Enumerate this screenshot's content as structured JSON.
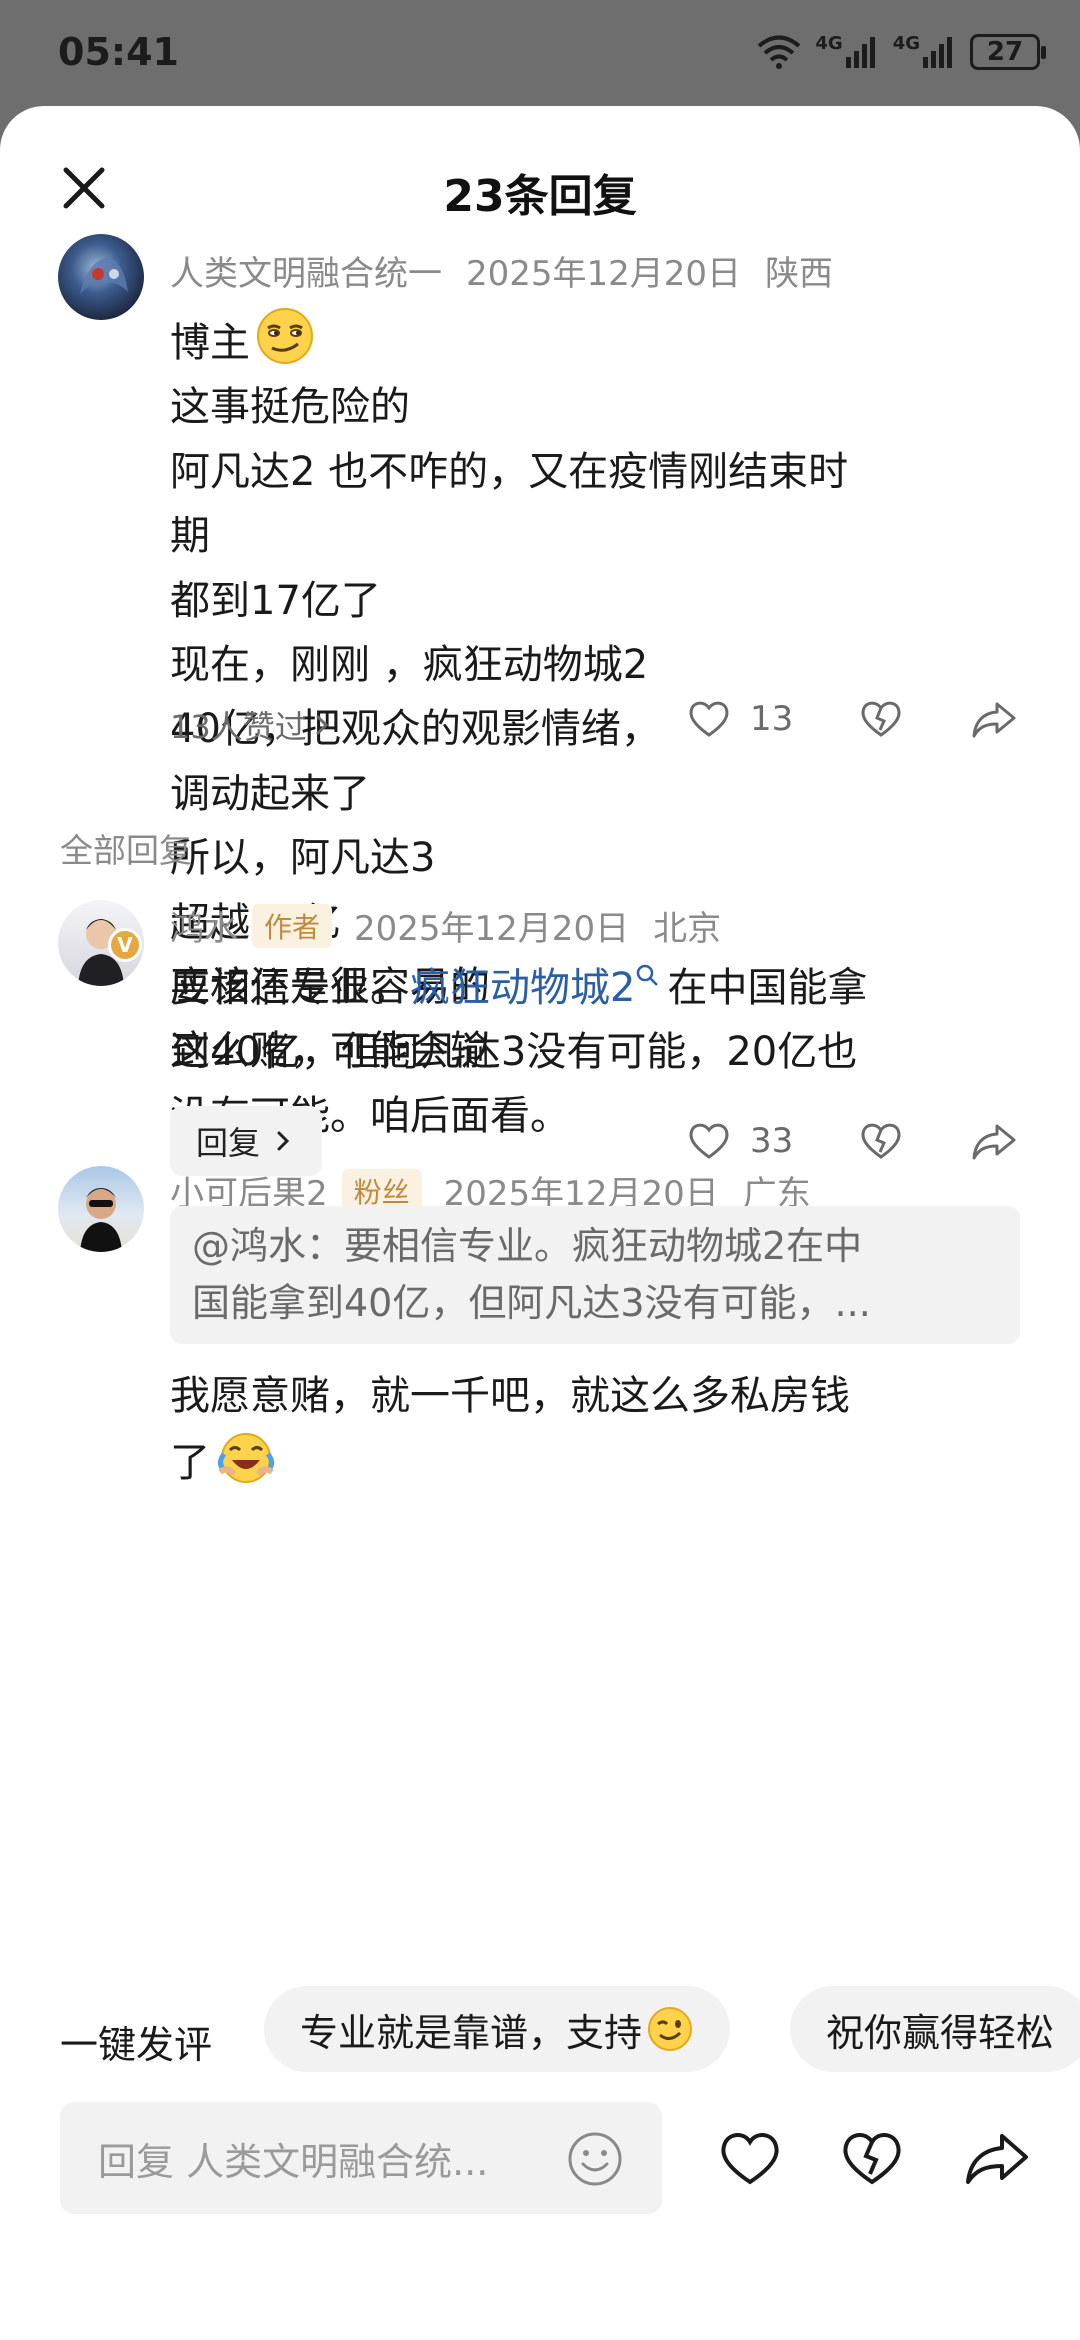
{
  "status_bar": {
    "time": "05:41",
    "network_1": "4G",
    "network_2": "4G",
    "battery": "27"
  },
  "sheet": {
    "title": "23条回复"
  },
  "main_comment": {
    "author": "人类文明融合统一",
    "date": "2025年12月20日",
    "location": "陕西",
    "lines": [
      "博主",
      "这事挺危险的",
      "阿凡达2 也不咋的，又在疫情刚结束时",
      "期",
      "都到17亿了",
      "现在，刚刚 ，疯狂动物城2",
      "40亿，把观众的观影情绪，",
      "调动起来了",
      "所以，阿凡达3",
      "超越20亿",
      "应该还是很容易的",
      "这么赌，可能会输"
    ],
    "likes_summary": "13人赞过",
    "like_count": "13"
  },
  "section_label": "全部回复",
  "replies": [
    {
      "author": "鸿水",
      "badge": "作者",
      "date": "2025年12月20日",
      "location": "北京",
      "text_line1_a": "要相信专业。",
      "text_line1_link": "疯狂动物城2",
      "text_line1_b": "在中国能拿",
      "text_line2": "到40亿，但阿凡达3没有可能，20亿也",
      "text_line3": "没有可能。咱后面看。",
      "reply_label": "回复",
      "like_count": "33"
    },
    {
      "author": "小可后果2",
      "badge": "粉丝",
      "date": "2025年12月20日",
      "location": "广东",
      "quote_line1": "@鸿水：要相信专业。疯狂动物城2在中",
      "quote_line2": "国能拿到40亿，但阿凡达3没有可能，...",
      "text_line1": "我愿意赌，就一千吧，就这么多私房钱",
      "text_line2": "了"
    }
  ],
  "quick_comments": {
    "label": "一键发评",
    "chips": [
      "专业就是靠谱，支持",
      "祝你赢得轻松"
    ]
  },
  "input": {
    "placeholder": "回复 人类文明融合统..."
  },
  "colors": {
    "link": "#2a5fa8",
    "badge_text": "#c08a3e",
    "badge_bg": "#fbf1e1",
    "muted": "#8a8a8a"
  }
}
